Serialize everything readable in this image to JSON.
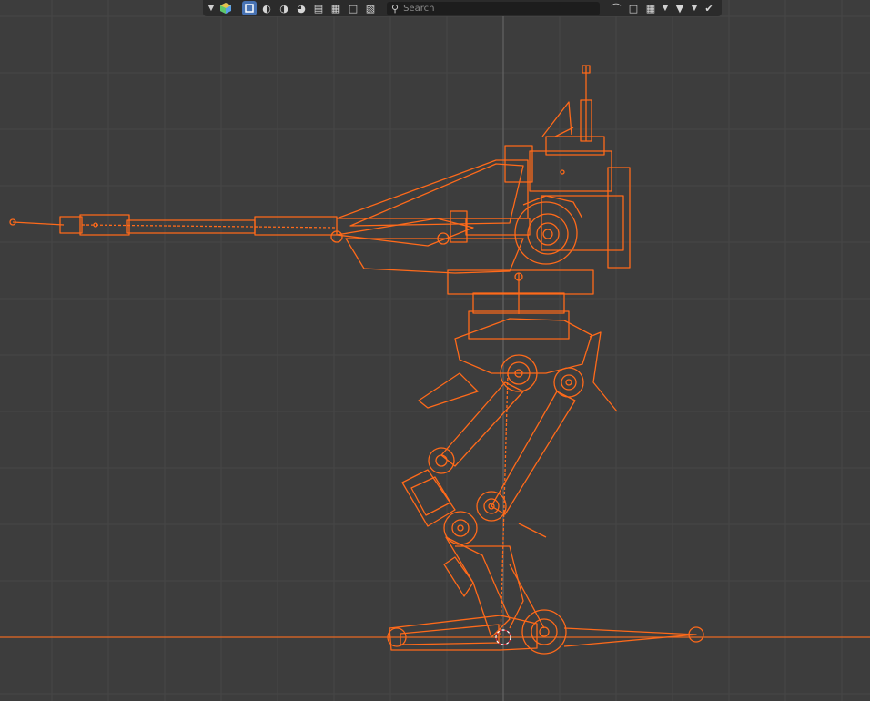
{
  "header": {
    "search": {
      "placeholder": "Search"
    }
  },
  "icons": {
    "dropdown": "chevron-down-icon",
    "color_cube": "color-cube-icon",
    "object": "object-icon",
    "shading": "shading-sphere-icon",
    "filter": "funnel-icon",
    "bookmark": "bookmark-icon",
    "check": "check-shield-icon"
  },
  "colors": {
    "viewport_bg": "#3d3d3d",
    "grid_minor": "#474747",
    "grid_major": "#525252",
    "wire": "#ff6a1a",
    "accent": "#4772b3"
  }
}
